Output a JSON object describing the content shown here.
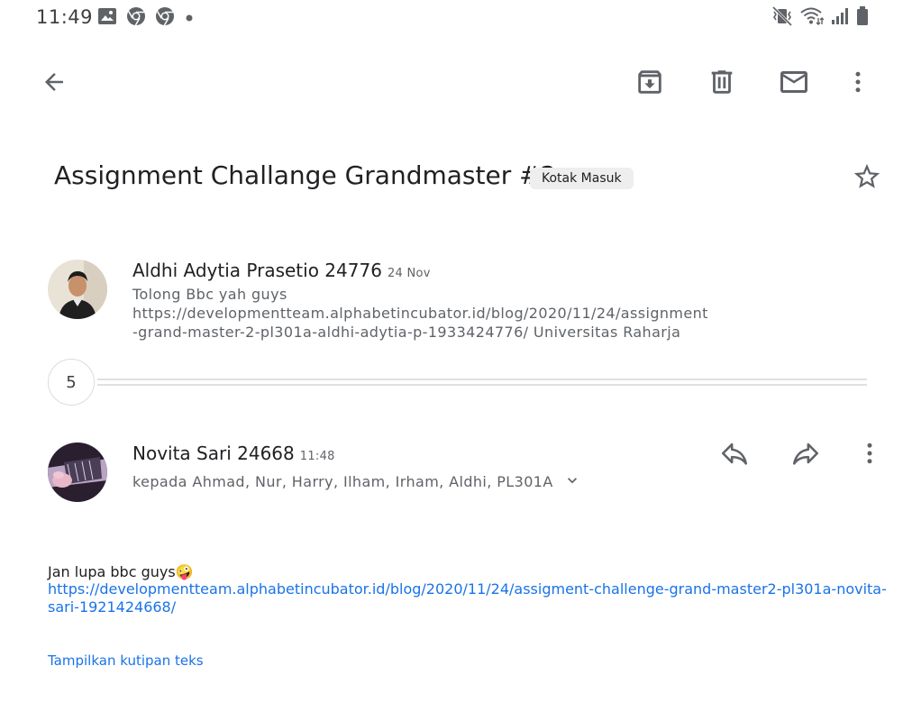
{
  "status_bar": {
    "time": "11:49",
    "left_icons": [
      "image-icon",
      "chrome-icon",
      "chrome-icon",
      "dot-icon"
    ],
    "right_icons": [
      "mute-vibrate-icon",
      "wifi-icon",
      "signal-icon",
      "battery-icon"
    ]
  },
  "toolbar": {
    "back": "back-arrow-icon",
    "actions": [
      "archive-icon",
      "delete-icon",
      "mark-unread-icon",
      "more-vert-icon"
    ]
  },
  "email": {
    "subject": "Assignment Challange Grandmaster #2",
    "label": "Kotak Masuk",
    "starred": false
  },
  "messages": [
    {
      "sender": "Aldhi Adytia Prasetio 24776",
      "time": "24 Nov",
      "snippet_line1": "Tolong Bbc yah guys https://developmentteam.alphabetincubator.id/blog/2020/11/24/assignment",
      "snippet_line2": "-grand-master-2-pl301a-aldhi-adytia-p-1933424776/ Universitas Raharja"
    },
    {
      "sender": "Novita Sari 24668",
      "time": "11:48",
      "recipients": "kepada Ahmad, Nur, Harry, Ilham, Irham, Aldhi, PL301A",
      "body_text": "Jan lupa bbc guys",
      "emoji": "🤪",
      "link_line1": "https://developmentteam.alphabetincubator.id/blog/2020/11/24/assigment-challenge-grand-master2-pl301a-novita-",
      "link_line2": "sari-1921424668/",
      "show_quoted": "Tampilkan kutipan teks"
    }
  ],
  "collapsed_count": "5",
  "colors": {
    "link": "#1a73e8",
    "text_primary": "#202124",
    "text_secondary": "#5f6368",
    "icon": "#5f6368",
    "chip_bg": "#eeeeee"
  }
}
